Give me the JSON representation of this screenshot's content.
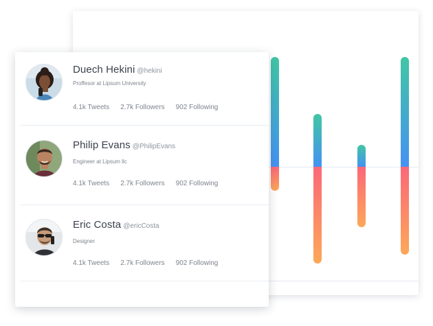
{
  "profiles": [
    {
      "name": "Duech Hekini",
      "handle": "@hekini",
      "title": "Proffesor at Lipsum University",
      "tweets": "4.1k Tweets",
      "followers": "2.7k Followers",
      "following": "902 Following"
    },
    {
      "name": "Philip Evans",
      "handle": "@PhilipEvans",
      "title": "Engineer at Lipsum llc",
      "tweets": "4.1k Tweets",
      "followers": "2.7k Followers",
      "following": "902 Following"
    },
    {
      "name": "Eric Costa",
      "handle": "@ericCosta",
      "title": "Designer",
      "tweets": "4.1k Tweets",
      "followers": "2.7k Followers",
      "following": "902 Following"
    }
  ],
  "chart_data": {
    "type": "bar",
    "series": [
      {
        "values": [
          1.0,
          0.48,
          0.2,
          1.0
        ]
      },
      {
        "values": [
          -0.22,
          -0.88,
          -0.55,
          -0.8
        ]
      }
    ],
    "colors": {
      "positive_top": "#41c6a4",
      "positive_bottom": "#4592f2",
      "negative_top": "#fb6878",
      "negative_bottom": "#fca859"
    }
  }
}
